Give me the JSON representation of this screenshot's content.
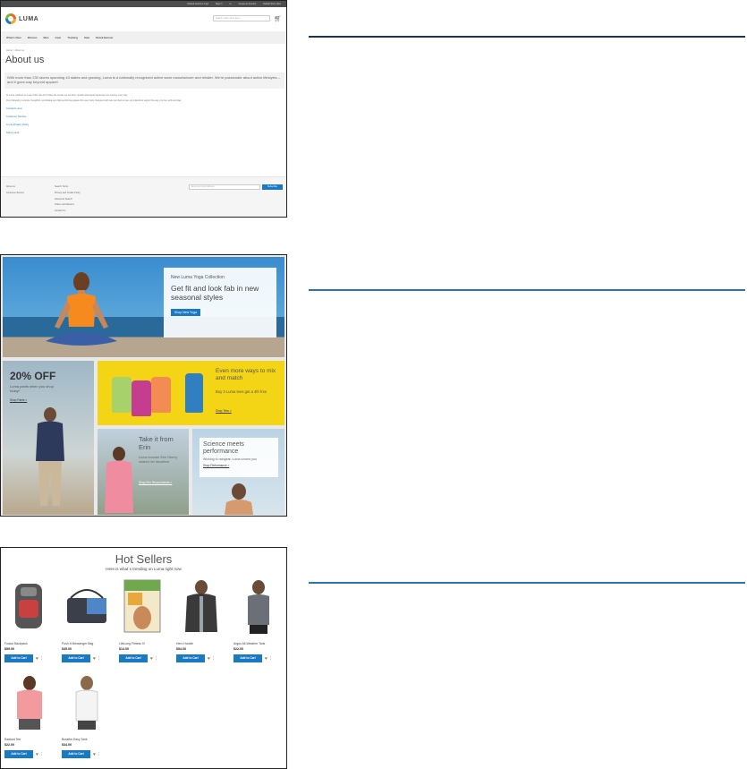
{
  "shot1": {
    "topbar": [
      "Default welcome msg!",
      "Sign In",
      "or",
      "Create an Account",
      "Default Store View"
    ],
    "logo": "LUMA",
    "search_placeholder": "Search entire store here...",
    "nav": [
      "What's New",
      "Women",
      "Men",
      "Gear",
      "Training",
      "Sale",
      "Retail Banner"
    ],
    "breadcrumb": "Home  >  About us",
    "title": "About us",
    "intro": "With more than 230 stores spanning 43 states and growing, Luma is a nationally recognized active wear manufacturer and retailer. We're passionate about active lifestyles – and it goes way beyond apparel.",
    "para1": "At Luma, wellness is a way of life. We don't follow the trends, we set them. Quality activewear that keeps you moving, every day.",
    "para2": "Our philosophy is simple: thoughtful, comfortable and high-performing apparel for every body. Designed with care and built to last, our collections support the way you live, work and play.",
    "links": [
      "Contact Luma",
      "Customer Service",
      "Luma Privacy Policy",
      "Shop Luma"
    ],
    "footer_col1": [
      "About us",
      "Customer Service"
    ],
    "footer_col2": [
      "Search Terms",
      "Privacy and Cookie Policy",
      "Advanced Search",
      "Orders and Returns",
      "Contact Us"
    ],
    "newsletter_placeholder": "Enter your email address",
    "subscribe": "Subscribe"
  },
  "shot2": {
    "hero_kicker": "New Luma Yoga Collection",
    "hero_title": "Get fit and look fab in new seasonal styles",
    "hero_button": "Shop New Yoga",
    "promo1_title": "20% OFF",
    "promo1_sub": "Luma pants when you shop today*",
    "promo1_link": "Shop Pants >",
    "promo2_title": "Even more ways to mix and match",
    "promo2_sub": "Buy 3 Luma tees get a 4th free",
    "promo2_link": "Shop Tees >",
    "promo3_title": "Take it from Erin",
    "promo3_sub": "Luma founder Erin Renny shares her favorites!",
    "promo3_link": "Shop Erin Recommends >",
    "promo4_title": "Science meets performance",
    "promo4_sub": "Wicking to raingear, Luma covers you",
    "promo4_link": "Shop Performance >",
    "colors": {
      "green": "#a7d16b",
      "magenta": "#c43d8e",
      "orange": "#f28c52",
      "blue": "#2f7fc1",
      "brand": "#1979c3"
    }
  },
  "shot3": {
    "title": "Hot Sellers",
    "subtitle": "Here is what`s trending on Luma right now",
    "add_label": "Add to Cart",
    "products": [
      {
        "name": "Fusion Backpack",
        "price": "$59.00"
      },
      {
        "name": "Push It Messenger Bag",
        "price": "$45.00"
      },
      {
        "name": "LifeLong Fitness IV",
        "price": "$14.00"
      },
      {
        "name": "Hero Hoodie",
        "price": "$54.00"
      },
      {
        "name": "Argus All-Weather Tank",
        "price": "$22.00"
      },
      {
        "name": "Radiant Tee",
        "price": "$22.00"
      },
      {
        "name": "Breathe-Easy Tank",
        "price": "$34.00"
      }
    ]
  }
}
